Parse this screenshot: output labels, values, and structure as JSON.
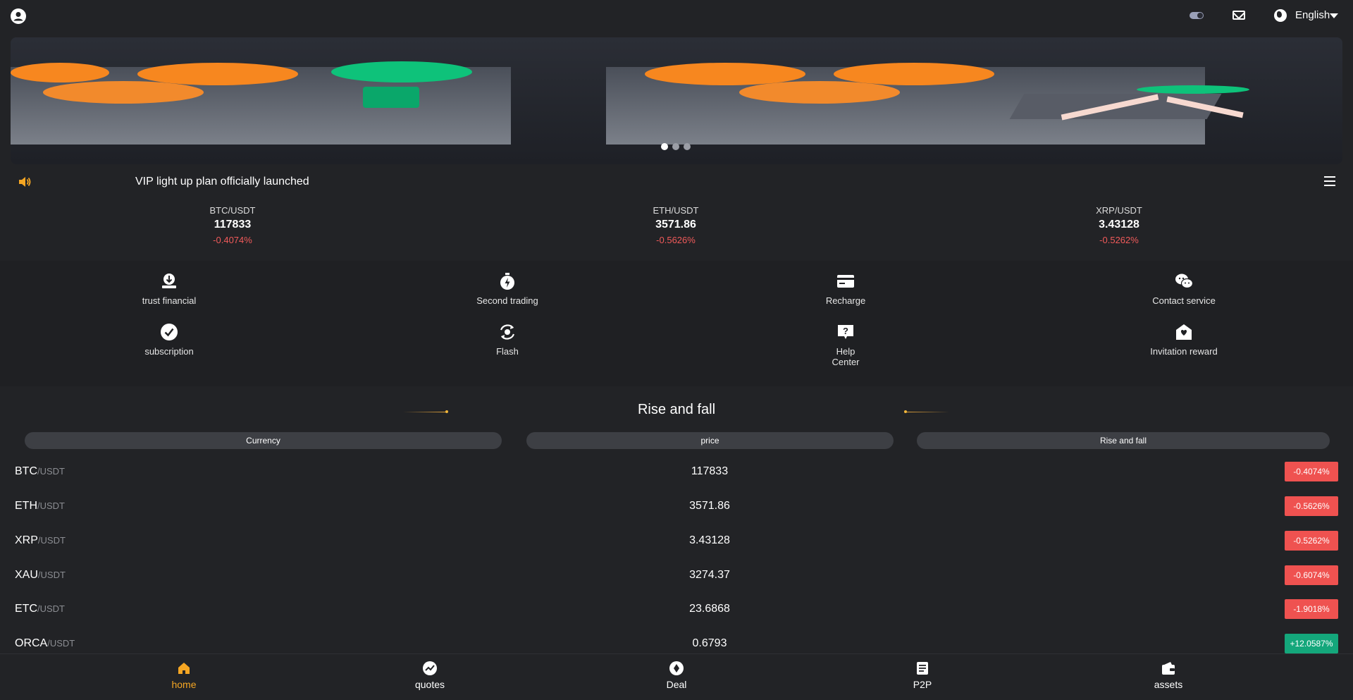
{
  "topbar": {
    "language": "English",
    "icons": [
      "user-icon",
      "theme-toggle-icon",
      "mail-icon",
      "globe-icon",
      "caret-down-icon"
    ]
  },
  "banner": {
    "slides": 3,
    "active_slide": 1
  },
  "notice": {
    "text": "VIP light up plan officially launched"
  },
  "tickers": [
    {
      "pair": "BTC/USDT",
      "price": "117833",
      "change": "-0.4074%"
    },
    {
      "pair": "ETH/USDT",
      "price": "3571.86",
      "change": "-0.5626%"
    },
    {
      "pair": "XRP/USDT",
      "price": "3.43128",
      "change": "-0.5262%"
    }
  ],
  "features": [
    {
      "label": "trust financial",
      "icon": "trust-financial-icon"
    },
    {
      "label": "Second trading",
      "icon": "stopwatch-icon"
    },
    {
      "label": "Recharge",
      "icon": "card-icon"
    },
    {
      "label": "Contact service",
      "icon": "chat-icon"
    },
    {
      "label": "subscription",
      "icon": "check-circle-icon"
    },
    {
      "label": "Flash",
      "icon": "exchange-icon"
    },
    {
      "label": "Help Center",
      "icon": "help-icon"
    },
    {
      "label": "Invitation reward",
      "icon": "gift-icon"
    }
  ],
  "market": {
    "title": "Rise and fall",
    "headers": {
      "currency": "Currency",
      "price": "price",
      "change": "Rise and fall"
    },
    "rows": [
      {
        "base": "BTC",
        "quote": "/USDT",
        "price": "117833",
        "change": "-0.4074%"
      },
      {
        "base": "ETH",
        "quote": "/USDT",
        "price": "3571.86",
        "change": "-0.5626%"
      },
      {
        "base": "XRP",
        "quote": "/USDT",
        "price": "3.43128",
        "change": "-0.5262%"
      },
      {
        "base": "XAU",
        "quote": "/USDT",
        "price": "3274.37",
        "change": "-0.6074%"
      },
      {
        "base": "ETC",
        "quote": "/USDT",
        "price": "23.6868",
        "change": "-1.9018%"
      },
      {
        "base": "ORCA",
        "quote": "/USDT",
        "price": "0.6793",
        "change": "+12.0587%"
      }
    ]
  },
  "colors": {
    "accent": "#f5a623",
    "down": "#ef5250",
    "up": "#14a77b",
    "background": "#222326"
  },
  "tabbar": {
    "items": [
      {
        "label": "home",
        "icon": "home-icon"
      },
      {
        "label": "quotes",
        "icon": "chart-icon"
      },
      {
        "label": "Deal",
        "icon": "deal-icon"
      },
      {
        "label": "P2P",
        "icon": "document-icon"
      },
      {
        "label": "assets",
        "icon": "wallet-icon"
      }
    ]
  }
}
